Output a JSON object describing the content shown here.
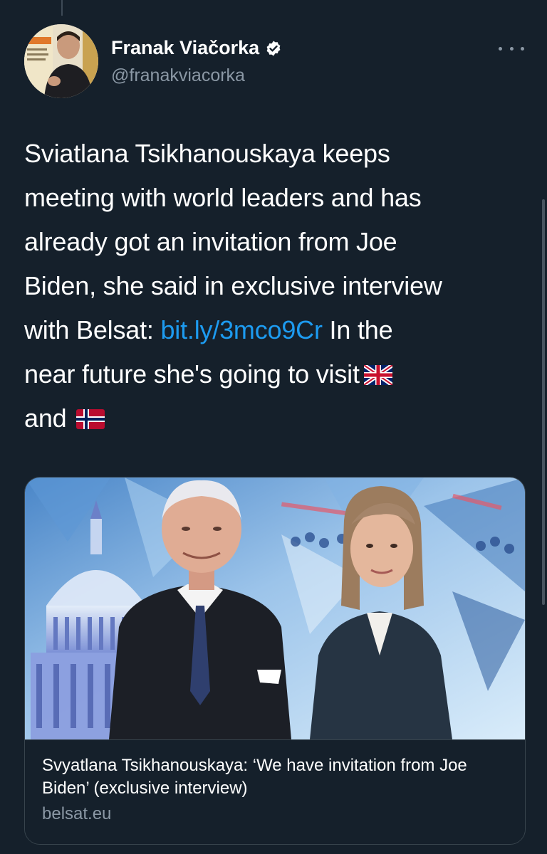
{
  "user": {
    "display_name": "Franak Viačorka",
    "handle": "@franakviacorka",
    "verified": true
  },
  "tweet": {
    "line1": "Sviatlana Tsikhanouskaya keeps",
    "line2": "meeting with world leaders and has",
    "line3": "already got an invitation from Joe",
    "line4": "Biden, she said in exclusive interview",
    "line5_prefix": "with Belsat: ",
    "link": "bit.ly/3mco9Cr",
    "line5_suffix": " In the",
    "line6": "near future she's going to visit",
    "line7": "and",
    "flags": [
      "united-kingdom-flag",
      "norway-flag"
    ]
  },
  "card": {
    "title": "Svyatlana Tsikhanouskaya: ‘We have invitation from Joe Biden’ (exclusive interview)",
    "domain": "belsat.eu"
  },
  "colors": {
    "background": "#15202b",
    "link": "#1d9bf0",
    "secondary_text": "#8b98a5",
    "border": "#38444d"
  }
}
